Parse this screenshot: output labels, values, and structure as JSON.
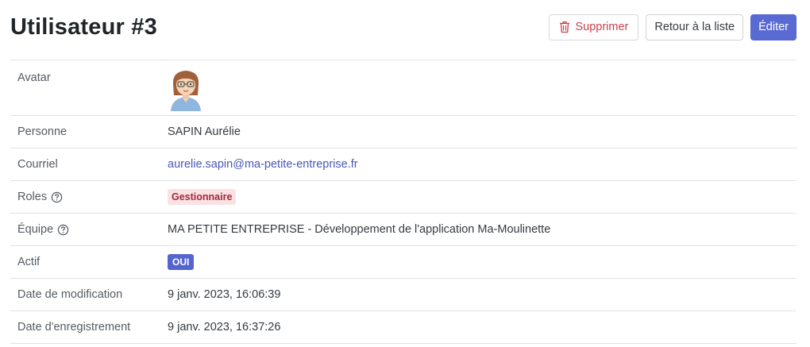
{
  "header": {
    "title": "Utilisateur #3",
    "delete_label": "Supprimer",
    "back_label": "Retour à la liste",
    "edit_label": "Éditer"
  },
  "details": {
    "avatar_label": "Avatar",
    "person_label": "Personne",
    "person_value": "SAPIN Aurélie",
    "email_label": "Courriel",
    "email_value": "aurelie.sapin@ma-petite-entreprise.fr",
    "roles_label": "Roles",
    "roles_value": "Gestionnaire",
    "team_label": "Équipe",
    "team_value": "MA PETITE ENTREPRISE - Développement de l'application Ma-Moulinette",
    "active_label": "Actif",
    "active_value": "OUI",
    "modified_label": "Date de modification",
    "modified_value": "9 janv. 2023, 16:06:39",
    "registered_label": "Date d'enregistrement",
    "registered_value": "9 janv. 2023, 16:37:26"
  },
  "colors": {
    "primary": "#5565cf",
    "danger": "#c8414f",
    "role_badge_bg": "#fbe1e4"
  }
}
